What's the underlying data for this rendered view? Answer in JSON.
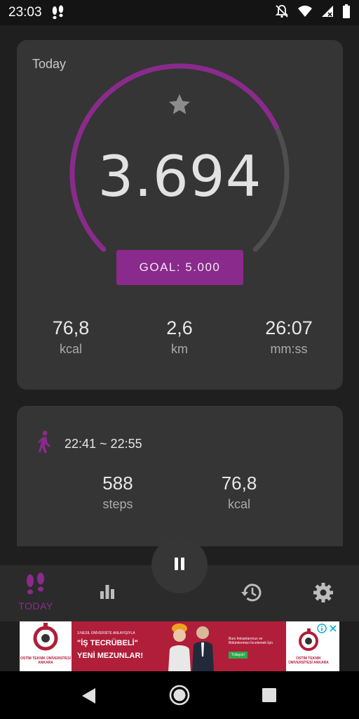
{
  "status_bar": {
    "time": "23:03"
  },
  "today": {
    "label": "Today",
    "steps": "3.694",
    "goal_button": "GOAL: 5.000",
    "goal_progress": 0.7388,
    "stats": [
      {
        "value": "76,8",
        "unit": "kcal"
      },
      {
        "value": "2,6",
        "unit": "km"
      },
      {
        "value": "26:07",
        "unit": "mm:ss"
      }
    ]
  },
  "session": {
    "time_range": "22:41 ~ 22:55",
    "steps_value": "588",
    "steps_unit": "steps",
    "kcal_value": "76,8",
    "kcal_unit": "kcal"
  },
  "bottom_nav": {
    "today_label": "TODAY"
  },
  "ad": {
    "left_logo": "OSTİM TEKNİK ÜNİVERSİTESİ ANKARA",
    "small_text": "3.NESİL ÜNİVERSİTE ANLAYIŞIYLA",
    "headline_1": "\"İŞ TECRÜBELİ\"",
    "headline_2": "YENİ MEZUNLAR!",
    "right_text_1": "Burs İmkanlarımızı ve",
    "right_text_2": "Bölümlerimizi İncelemek İçin",
    "cta": "Tıklayın!",
    "right_logo": "OSTİM TEKNİK ÜNİVERSİTESİ ANKARA"
  },
  "colors": {
    "accent": "#8a2a8c",
    "ring_track": "#4e4e4e",
    "card_bg": "#353535",
    "page_bg": "#1f1f1f"
  },
  "icons": {
    "status_steps": "footsteps-icon",
    "status_dnd": "notifications-off-icon",
    "status_wifi": "wifi-icon",
    "status_signal": "signal-icon",
    "status_battery": "battery-icon",
    "goal_star": "star-icon",
    "walker": "walking-person-icon",
    "nav_today": "footsteps-icon",
    "nav_report": "bar-chart-icon",
    "nav_history": "history-icon",
    "nav_settings": "gear-icon",
    "pause": "pause-icon"
  }
}
